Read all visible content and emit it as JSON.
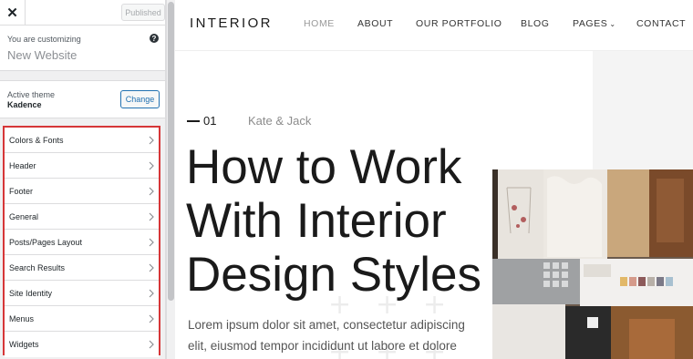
{
  "sidebar": {
    "close_label": "✕",
    "published_label": "Published",
    "customizing_label": "You are customizing",
    "site_name": "New Website",
    "help_label": "?",
    "active_theme_label": "Active theme",
    "theme_name": "Kadence",
    "change_label": "Change",
    "highlight_color": "#d63638",
    "sections": [
      {
        "label": "Colors & Fonts"
      },
      {
        "label": "Header"
      },
      {
        "label": "Footer"
      },
      {
        "label": "General"
      },
      {
        "label": "Posts/Pages Layout"
      },
      {
        "label": "Search Results"
      },
      {
        "label": "Site Identity"
      },
      {
        "label": "Menus"
      },
      {
        "label": "Widgets"
      }
    ]
  },
  "preview": {
    "logo": "INTERIOR",
    "nav": {
      "home": "HOME",
      "about": "ABOUT",
      "portfolio": "OUR PORTFOLIO",
      "blog": "BLOG",
      "pages": "PAGES",
      "contact": "CONTACT"
    },
    "active_nav_color": "#999999",
    "hero": {
      "number": "01",
      "author": "Kate & Jack",
      "title_lines": [
        "How to Work",
        "With Interior",
        "Design Styles"
      ],
      "paragraph_lines": [
        "Lorem ipsum dolor sit amet, consectetur adipiscing",
        "elit, eiusmod tempor incididunt ut labore et dolore"
      ]
    }
  }
}
